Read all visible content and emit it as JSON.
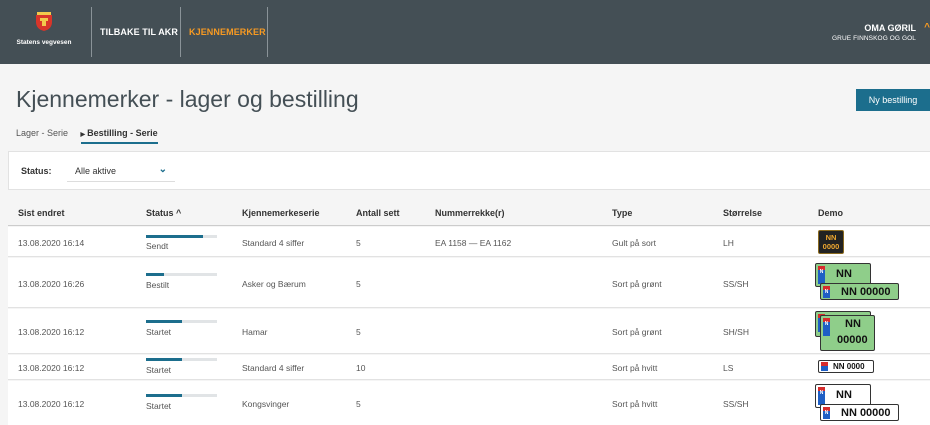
{
  "header": {
    "logo_text": "Statens vegvesen",
    "nav": [
      {
        "label": "TILBAKE TIL AKR",
        "active": false
      },
      {
        "label": "KJENNEMERKER",
        "active": true
      }
    ],
    "user_name": "OMA GØRIL",
    "user_org": "GRUE FINNSKOG OG GOL",
    "accent": "#f79a22",
    "bg": "#444f55"
  },
  "page": {
    "title": "Kjennemerker - lager og bestilling",
    "new_button": "Ny bestilling",
    "tabs": [
      "Lager - Serie",
      "Bestilling - Serie"
    ],
    "active_tab": "Bestilling - Serie"
  },
  "filter": {
    "label": "Status:",
    "value": "Alle aktive"
  },
  "table": {
    "headers": [
      "Sist endret",
      "Status",
      "Kjennemerkeserie",
      "Antall sett",
      "Nummerrekke(r)",
      "Type",
      "Størrelse",
      "Demo"
    ],
    "sort_indicator": "^",
    "rows": [
      {
        "date": "13.08.2020 16:14",
        "status": "Sendt",
        "progress": 0.8,
        "series": "Standard 4 siffer",
        "count": "5",
        "range": "EA 1158 — EA 1162",
        "type": "Gult på sort",
        "size": "LH",
        "demo": {
          "lines": [
            "NN",
            "0000"
          ]
        }
      },
      {
        "date": "13.08.2020 16:26",
        "status": "Bestilt",
        "progress": 0.25,
        "series": "Asker og Bærum",
        "count": "5",
        "range": "",
        "type": "Sort på grønt",
        "size": "SS/SH",
        "demo": {
          "small": "NN",
          "large": "NN 00000"
        }
      },
      {
        "date": "13.08.2020 16:12",
        "status": "Startet",
        "progress": 0.5,
        "series": "Hamar",
        "count": "5",
        "range": "",
        "type": "Sort på grønt",
        "size": "SH/SH",
        "demo": {
          "lines": [
            "NN",
            "00000"
          ]
        }
      },
      {
        "date": "13.08.2020 16:12",
        "status": "Startet",
        "progress": 0.5,
        "series": "Standard 4 siffer",
        "count": "10",
        "range": "",
        "type": "Sort på hvitt",
        "size": "LS",
        "demo": {
          "text": "NN 0000"
        }
      },
      {
        "date": "13.08.2020 16:12",
        "status": "Startet",
        "progress": 0.5,
        "series": "Kongsvinger",
        "count": "5",
        "range": "",
        "type": "Sort på hvitt",
        "size": "SS/SH",
        "demo": {
          "small": "NN",
          "large": "NN 00000"
        }
      }
    ]
  }
}
